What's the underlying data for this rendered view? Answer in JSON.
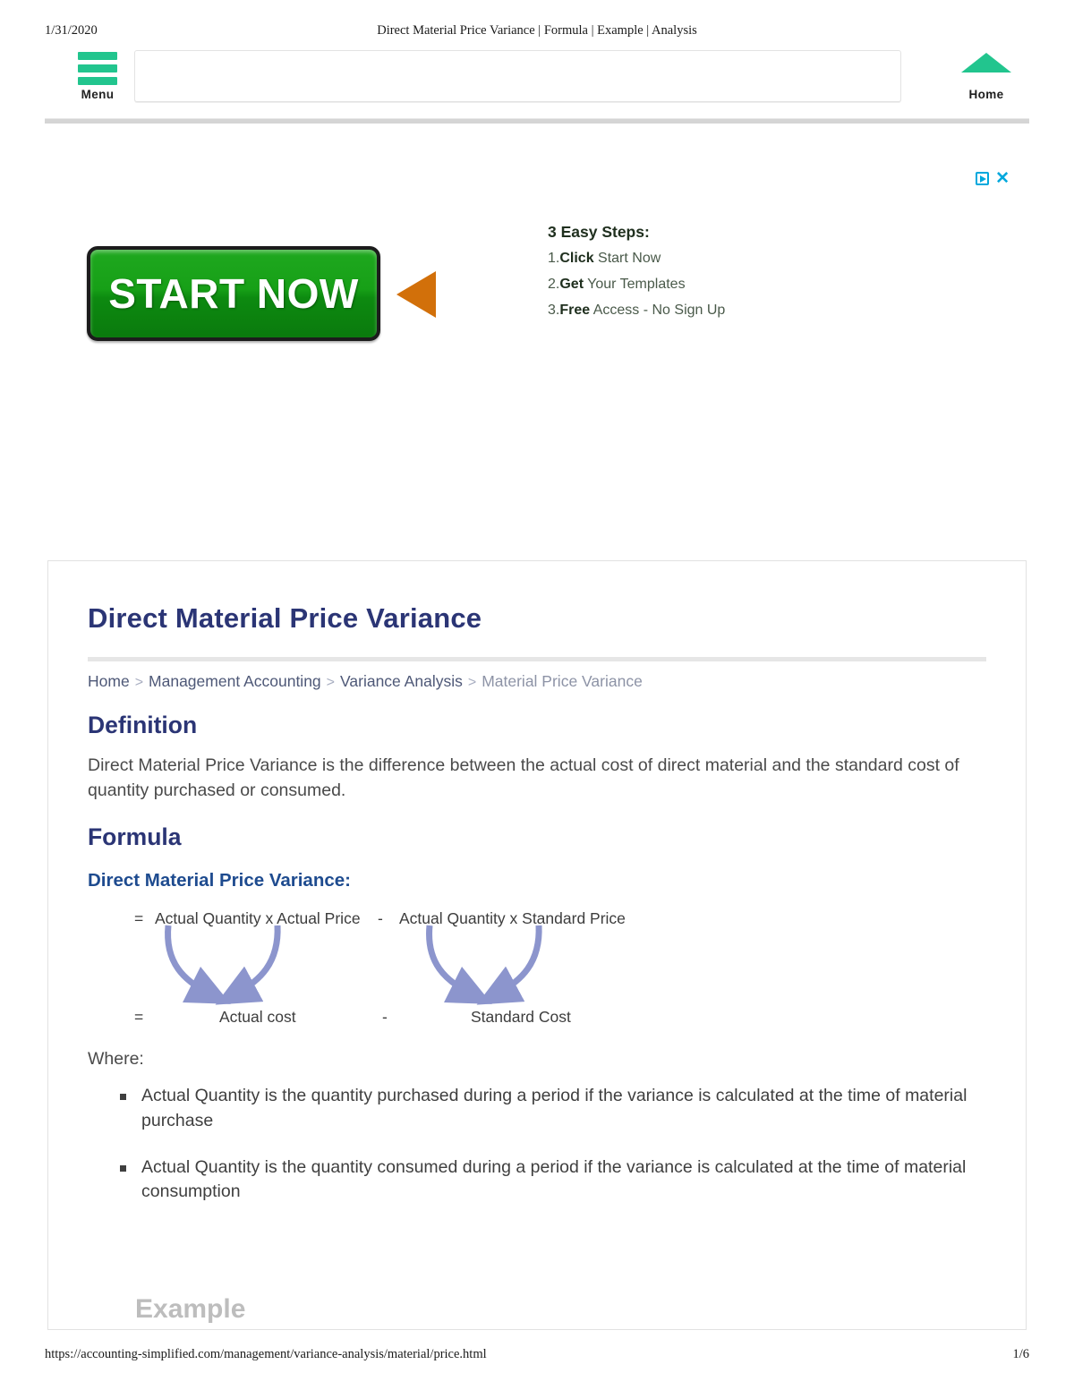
{
  "print_header": {
    "date": "1/31/2020",
    "title": "Direct Material Price Variance | Formula | Example | Analysis"
  },
  "nav": {
    "menu_label": "Menu",
    "search_value": "",
    "search_placeholder": "",
    "home_label": "Home",
    "accent_color": "#22c58e"
  },
  "ad": {
    "adchoices_icon": "adchoices-triangle-icon",
    "close_icon": "close-x-icon",
    "control_color": "#00a8dd",
    "cta_label": "START NOW",
    "cta_color": "#17a017",
    "arrow_color": "#d2700a",
    "steps_title": "3 Easy Steps:",
    "steps": [
      {
        "num": "1.",
        "keyword": "Click",
        "rest": " Start Now"
      },
      {
        "num": "2.",
        "keyword": "Get",
        "rest": " Your Templates"
      },
      {
        "num": "3.",
        "keyword": "Free",
        "rest": " Access - No Sign Up"
      }
    ]
  },
  "article": {
    "title": "Direct Material Price Variance",
    "title_color": "#2b3575",
    "breadcrumb": {
      "items": [
        "Home",
        "Management Accounting",
        "Variance Analysis"
      ],
      "separator": ">",
      "current": "Material Price Variance"
    },
    "definition": {
      "heading": "Definition",
      "text": "Direct Material Price Variance is the difference between the actual cost of direct material and the standard cost of quantity purchased or consumed."
    },
    "formula": {
      "heading": "Formula",
      "label": "Direct Material Price Variance:",
      "top_row": {
        "equals": "=",
        "term1": "Actual Quantity x Actual Price",
        "operator": "-",
        "term2": "Actual Quantity x Standard Price"
      },
      "bottom_row": {
        "equals": "=",
        "term1": "Actual cost",
        "operator": "-",
        "term2": "Standard Cost"
      },
      "arrow_color": "#8c95cd"
    },
    "where": {
      "label": "Where:",
      "items": [
        "Actual Quantity is the quantity purchased during a period if the variance is calculated at the time of material purchase",
        "Actual Quantity is the quantity consumed during a period if the variance is calculated at the time of material consumption"
      ]
    },
    "example_heading": "Example"
  },
  "print_footer": {
    "url": "https://accounting-simplified.com/management/variance-analysis/material/price.html",
    "page": "1/6"
  }
}
